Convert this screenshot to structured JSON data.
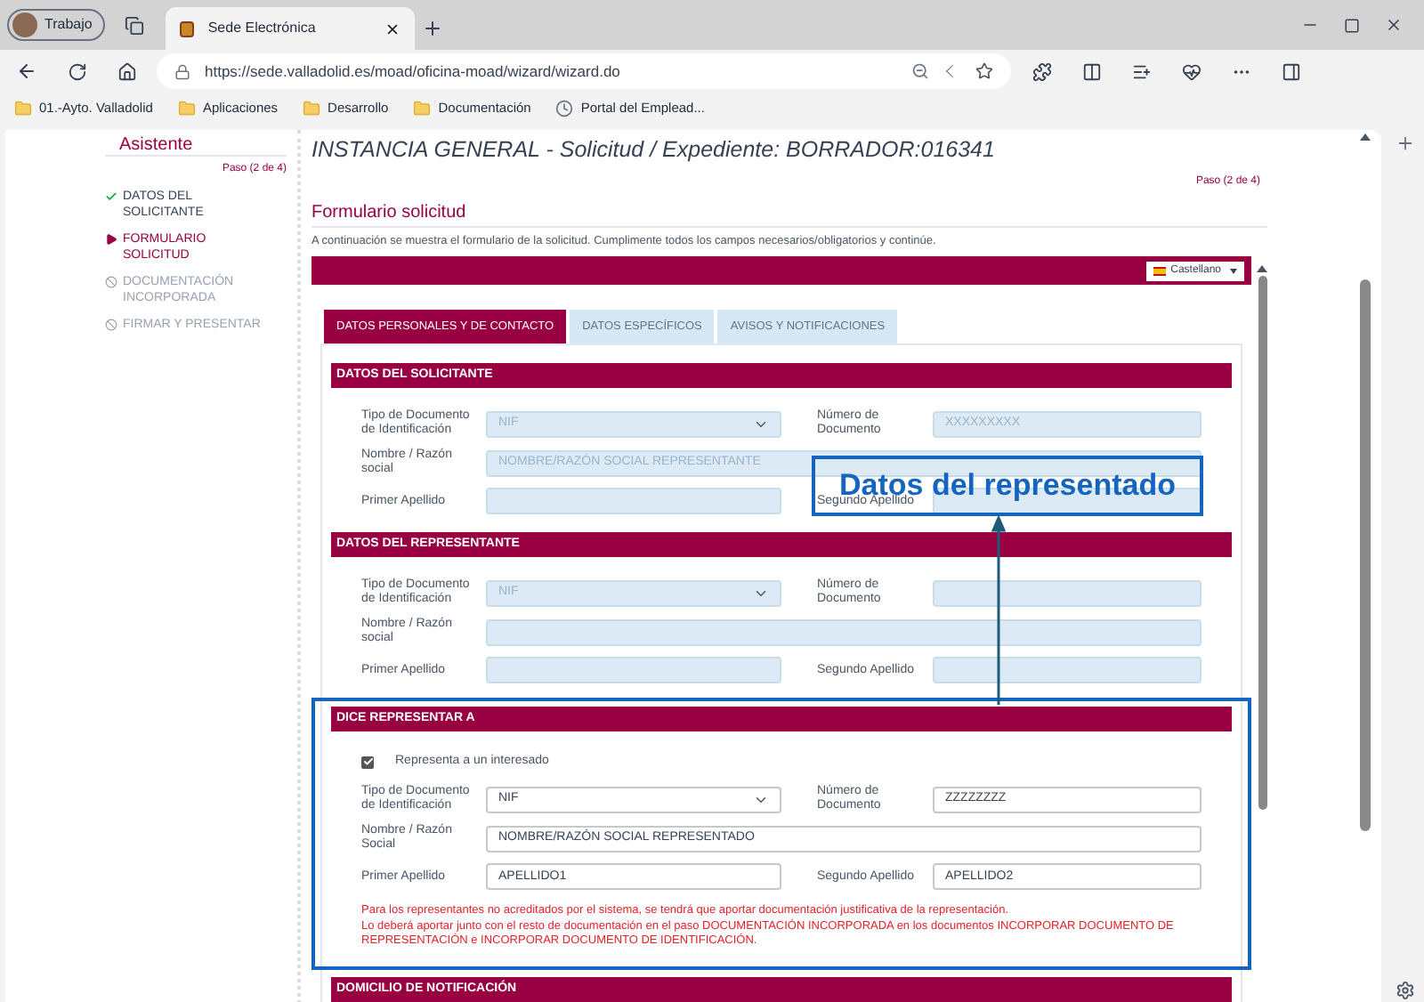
{
  "browser": {
    "profile": "Trabajo",
    "tab_title": "Sede Electrónica",
    "url": "https://sede.valladolid.es/moad/oficina-moad/wizard/wizard.do",
    "bookmarks": [
      {
        "label": "01.-Ayto. Valladolid",
        "kind": "folder"
      },
      {
        "label": "Aplicaciones",
        "kind": "folder"
      },
      {
        "label": "Desarrollo",
        "kind": "folder"
      },
      {
        "label": "Documentación",
        "kind": "folder"
      },
      {
        "label": "Portal del Emplead...",
        "kind": "page"
      }
    ]
  },
  "sidebar": {
    "title": "Asistente",
    "step": "Paso (2 de 4)",
    "items": [
      {
        "label": "DATOS DEL SOLICITANTE",
        "kind": "done"
      },
      {
        "label": "FORMULARIO SOLICITUD",
        "kind": "current"
      },
      {
        "label": "DOCUMENTACIÓN INCORPORADA",
        "kind": "pending"
      },
      {
        "label": "FIRMAR Y PRESENTAR",
        "kind": "pending"
      }
    ]
  },
  "main": {
    "title": "INSTANCIA GENERAL - Solicitud / Expediente: BORRADOR:016341",
    "step": "Paso (2 de 4)",
    "form_title": "Formulario solicitud",
    "intro": "A continuación se muestra el formulario de la solicitud. Cumplimente todos los campos necesarios/obligatorios y continúe.",
    "language": "Castellano",
    "tabs": [
      {
        "label": "DATOS PERSONALES Y DE CONTACTO",
        "selected": true
      },
      {
        "label": "DATOS ESPECÍFICOS",
        "selected": false
      },
      {
        "label": "AVISOS Y NOTIFICACIONES",
        "selected": false
      }
    ],
    "sections": [
      {
        "header": "DATOS DEL SOLICITANTE",
        "disabled": true,
        "rows": [
          [
            {
              "label": "Tipo de Documento de Identificación",
              "kind": "select",
              "value": "NIF"
            },
            {
              "label": "Número de Documento",
              "kind": "text",
              "value": "XXXXXXXXX"
            }
          ],
          [
            {
              "label": "Nombre / Razón social",
              "kind": "text",
              "value": "NOMBRE/RAZÓN SOCIAL REPRESENTANTE"
            }
          ],
          [
            {
              "label": "Primer Apellido",
              "kind": "text"
            },
            {
              "label": "Segundo Apellido",
              "kind": "text"
            }
          ]
        ]
      },
      {
        "header": "DATOS DEL REPRESENTANTE",
        "disabled": true,
        "rows": [
          [
            {
              "label": "Tipo de Documento de Identificación",
              "kind": "select",
              "value": "NIF"
            },
            {
              "label": "Número de Documento",
              "kind": "text"
            }
          ],
          [
            {
              "label": "Nombre / Razón social",
              "kind": "text"
            }
          ],
          [
            {
              "label": "Primer Apellido",
              "kind": "text"
            },
            {
              "label": "Segundo Apellido",
              "kind": "text"
            }
          ]
        ]
      },
      {
        "header": "DICE REPRESENTAR A",
        "disabled": false,
        "highlighted": true,
        "checkbox": {
          "label": "Representa a un interesado",
          "checked": true
        },
        "rows": [
          [
            {
              "label": "Tipo de Documento de Identificación",
              "kind": "select",
              "value": "NIF"
            },
            {
              "label": "Número de Documento",
              "kind": "text",
              "value": "ZZZZZZZZ"
            }
          ],
          [
            {
              "label": "Nombre / Razón Social",
              "kind": "text",
              "value": "NOMBRE/RAZÓN SOCIAL REPRESENTADO"
            }
          ],
          [
            {
              "label": "Primer Apellido",
              "kind": "text",
              "value": "APELLIDO1"
            },
            {
              "label": "Segundo Apellido",
              "kind": "text",
              "value": "APELLIDO2"
            }
          ]
        ],
        "notes": [
          "Para los representantes no acreditados por el sistema, se tendrá que aportar documentación justificativa de la representación.",
          "Lo deberá aportar junto con el resto de documentación en el paso DOCUMENTACIÓN INCORPORADA en los documentos INCORPORAR DOCUMENTO DE REPRESENTACIÓN e INCORPORAR DOCUMENTO DE IDENTIFICACIÓN."
        ]
      },
      {
        "header": "DOMICILIO DE NOTIFICACIÓN"
      }
    ]
  },
  "annotation": {
    "label": "Datos del representado"
  }
}
